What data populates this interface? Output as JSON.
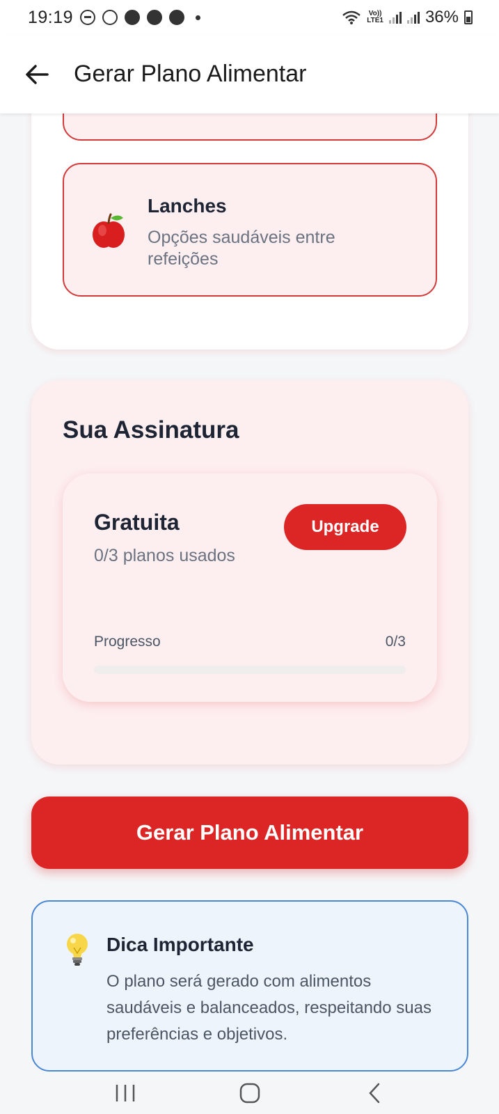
{
  "status_bar": {
    "time": "19:19",
    "battery_percent": "36%",
    "lte_top": "Vo))",
    "lte_bottom": "LTE1",
    "icons": [
      "do-not-disturb-icon",
      "whatsapp-icon",
      "discord-icon",
      "chrome-icon",
      "chrome-icon",
      "dot-icon",
      "wifi-icon",
      "signal-icon",
      "signal-icon",
      "battery-icon"
    ]
  },
  "app_bar": {
    "title": "Gerar Plano Alimentar",
    "back_icon": "arrow-left-icon"
  },
  "meal_options": [
    {
      "title": "Lanches",
      "description": "Opções saudáveis entre refeições",
      "icon": "apple-icon"
    }
  ],
  "subscription": {
    "section_title": "Sua Assinatura",
    "plan_name": "Gratuita",
    "usage_text": "0/3 planos usados",
    "upgrade_label": "Upgrade",
    "progress_label": "Progresso",
    "progress_value": "0/3",
    "progress_fraction": 0
  },
  "generate_button": {
    "label": "Gerar Plano Alimentar"
  },
  "tip": {
    "title": "Dica Importante",
    "text": "O plano será gerado com alimentos saudáveis e balanceados, respeitando suas preferências e objetivos.",
    "icon": "lightbulb-icon"
  },
  "colors": {
    "primary": "#dc2626",
    "card_tint": "#fdeef0",
    "tip_border": "#4a86d6",
    "tip_bg": "#eef4fc"
  },
  "nav_bar": {
    "icons": [
      "recent-apps-icon",
      "home-icon",
      "back-icon"
    ]
  }
}
